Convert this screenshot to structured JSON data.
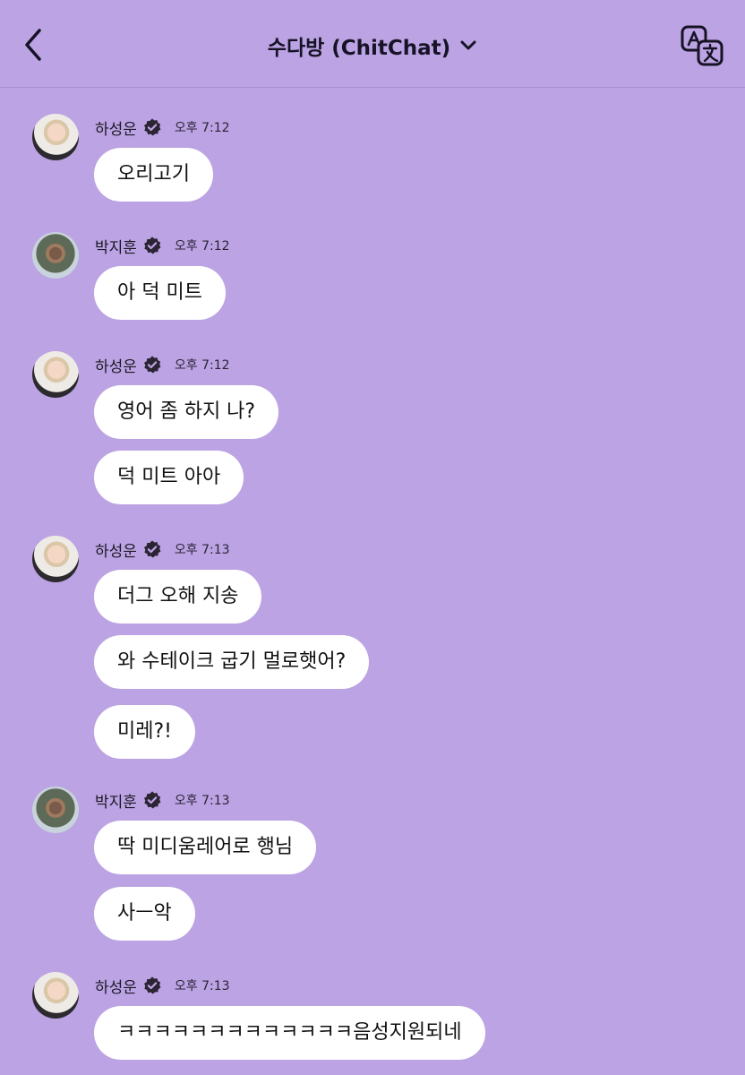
{
  "header": {
    "title": "수다방 (ChitChat)",
    "back_icon": "chevron-left-icon",
    "dropdown_icon": "chevron-down-icon",
    "translate_icon": "translate-icon"
  },
  "colors": {
    "background": "#bca3e3",
    "bubble": "#ffffff",
    "verified_badge": "#2a2433"
  },
  "messages": [
    {
      "sender": "하성운",
      "time": "오후 7:12",
      "bubbles": [
        "오리고기"
      ]
    },
    {
      "sender": "박지훈",
      "time": "오후 7:12",
      "bubbles": [
        "아 덕 미트"
      ]
    },
    {
      "sender": "하성운",
      "time": "오후 7:12",
      "bubbles": [
        "영어 좀 하지 나?",
        "덕 미트 아아"
      ]
    },
    {
      "sender": "하성운",
      "time": "오후 7:13",
      "bubbles": [
        "더그 오해 지송",
        "와 수테이크 굽기 멀로햇어?",
        "미레?!"
      ]
    },
    {
      "sender": "박지훈",
      "time": "오후 7:13",
      "bubbles": [
        "딱 미디움레어로 행님",
        "사ㅡ악"
      ]
    },
    {
      "sender": "하성운",
      "time": "오후 7:13",
      "bubbles": [
        "ㅋㅋㅋㅋㅋㅋㅋㅋㅋㅋㅋㅋㅋ음성지원되네"
      ]
    }
  ]
}
